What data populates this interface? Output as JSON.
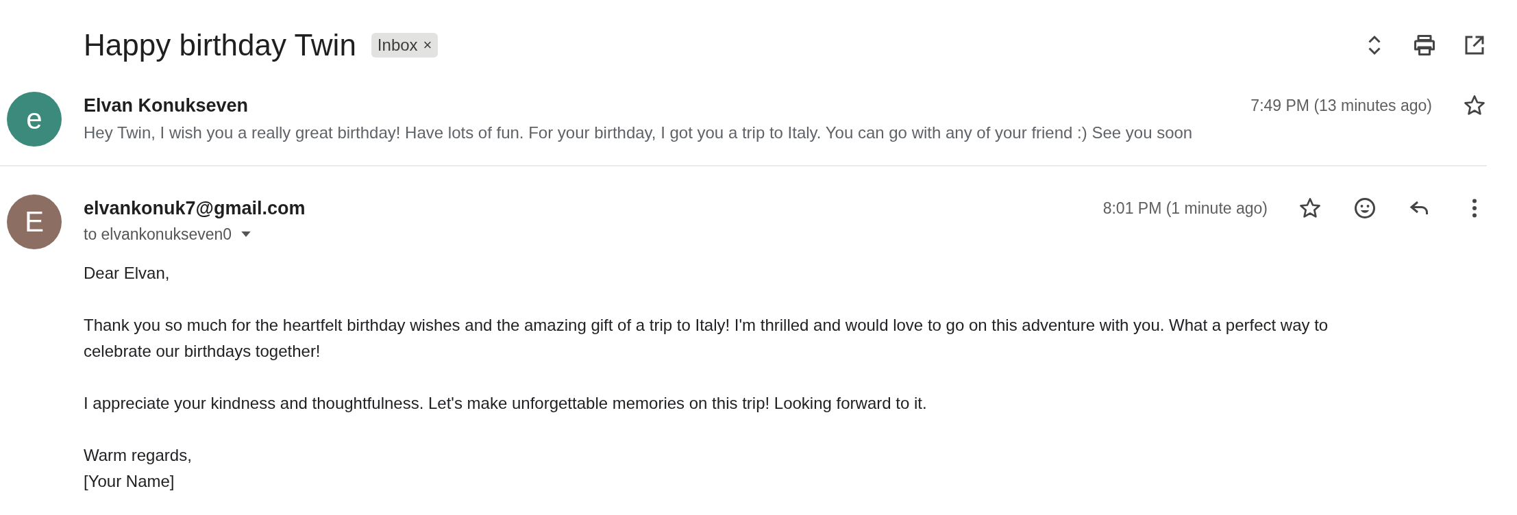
{
  "thread": {
    "subject": "Happy birthday Twin",
    "labels": [
      {
        "text": "Inbox",
        "close": "×"
      }
    ]
  },
  "messages": [
    {
      "avatar": {
        "letter": "e",
        "color": "#3b8a7b"
      },
      "sender": "Elvan Konukseven",
      "time": "7:49 PM (13 minutes ago)",
      "starred": false,
      "expanded": false,
      "snippet": "Hey Twin, I wish you a really great birthday! Have lots of fun. For your birthday, I got you a trip to Italy. You can go with any of your friend :) See you soon"
    },
    {
      "avatar": {
        "letter": "E",
        "color": "#8d6e63"
      },
      "sender": "elvankonuk7@gmail.com",
      "time": "8:01 PM (1 minute ago)",
      "starred": false,
      "expanded": true,
      "recipients": "to elvankonukseven0",
      "body": [
        {
          "lines": [
            "Dear Elvan,"
          ]
        },
        {
          "lines": [
            "Thank you so much for the heartfelt birthday wishes and the amazing gift of a trip to Italy! I'm thrilled and would love to go on this adventure with you. What a perfect way to celebrate our birthdays together!"
          ]
        },
        {
          "lines": [
            "I appreciate your kindness and thoughtfulness. Let's make unforgettable memories on this trip! Looking forward to it."
          ]
        },
        {
          "lines": [
            "Warm regards,",
            "[Your Name]"
          ]
        }
      ]
    }
  ]
}
